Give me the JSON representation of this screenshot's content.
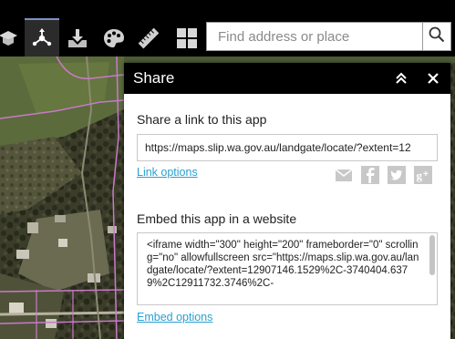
{
  "toolbar": {
    "tools": [
      {
        "icon": "graduation-cap-icon"
      },
      {
        "icon": "share-network-icon",
        "active": true
      },
      {
        "icon": "download-tray-icon"
      },
      {
        "icon": "palette-icon"
      },
      {
        "icon": "ruler-icon"
      },
      {
        "icon": "grid-icon"
      }
    ],
    "search": {
      "placeholder": "Find address or place",
      "icon": "search-icon"
    }
  },
  "share_panel": {
    "title": "Share",
    "collapse_icon": "double-chevron-up-icon",
    "close_icon": "close-icon",
    "link_section_label": "Share a link to this app",
    "link_value": "https://maps.slip.wa.gov.au/landgate/locate/?extent=12",
    "link_options_label": "Link options",
    "social_icons": [
      "email-icon",
      "facebook-icon",
      "twitter-icon",
      "google-plus-icon"
    ],
    "embed_section_label": "Embed this app in a website",
    "embed_value": "<iframe width=\"300\" height=\"200\" frameborder=\"0\" scrolling=\"no\" allowfullscreen src=\"https://maps.slip.wa.gov.au/landgate/locate/?extent=12907146.1529%2C-3740404.6379%2C12911732.3746%2C-",
    "embed_options_label": "Embed options"
  },
  "colors": {
    "accent_link": "#2aa1cf",
    "header_bg": "#000000",
    "active_tool_border": "#7a92c8",
    "boundary_line": "#c87ac8"
  }
}
